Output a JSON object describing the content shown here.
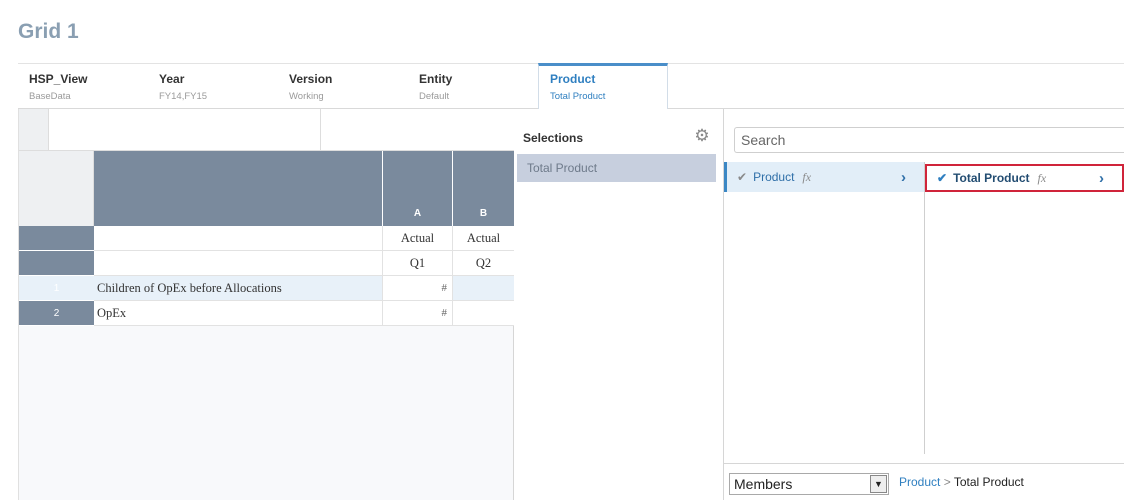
{
  "title": "Grid 1",
  "pov": [
    {
      "dimension": "HSP_View",
      "member": "BaseData"
    },
    {
      "dimension": "Year",
      "member": "FY14,FY15"
    },
    {
      "dimension": "Version",
      "member": "Working"
    },
    {
      "dimension": "Entity",
      "member": "Default"
    },
    {
      "dimension": "Product",
      "member": "Total Product"
    }
  ],
  "grid": {
    "columns": [
      "A",
      "B"
    ],
    "header_rows": [
      [
        "Actual",
        "Actual"
      ],
      [
        "Q1",
        "Q2"
      ]
    ],
    "rows": [
      {
        "num": "1",
        "label": "Children of OpEx before Allocations",
        "values": [
          "#",
          ""
        ]
      },
      {
        "num": "2",
        "label": "OpEx",
        "values": [
          "#",
          ""
        ]
      }
    ]
  },
  "selections": {
    "title": "Selections",
    "items": [
      "Total Product"
    ]
  },
  "member_selector": {
    "search_placeholder": "Search",
    "column1": {
      "label": "Product",
      "fx": "fx"
    },
    "column2": {
      "label": "Total Product",
      "fx": "fx"
    },
    "filter_value": "Members",
    "breadcrumb": {
      "root": "Product",
      "separator": ">",
      "current": "Total Product"
    }
  }
}
